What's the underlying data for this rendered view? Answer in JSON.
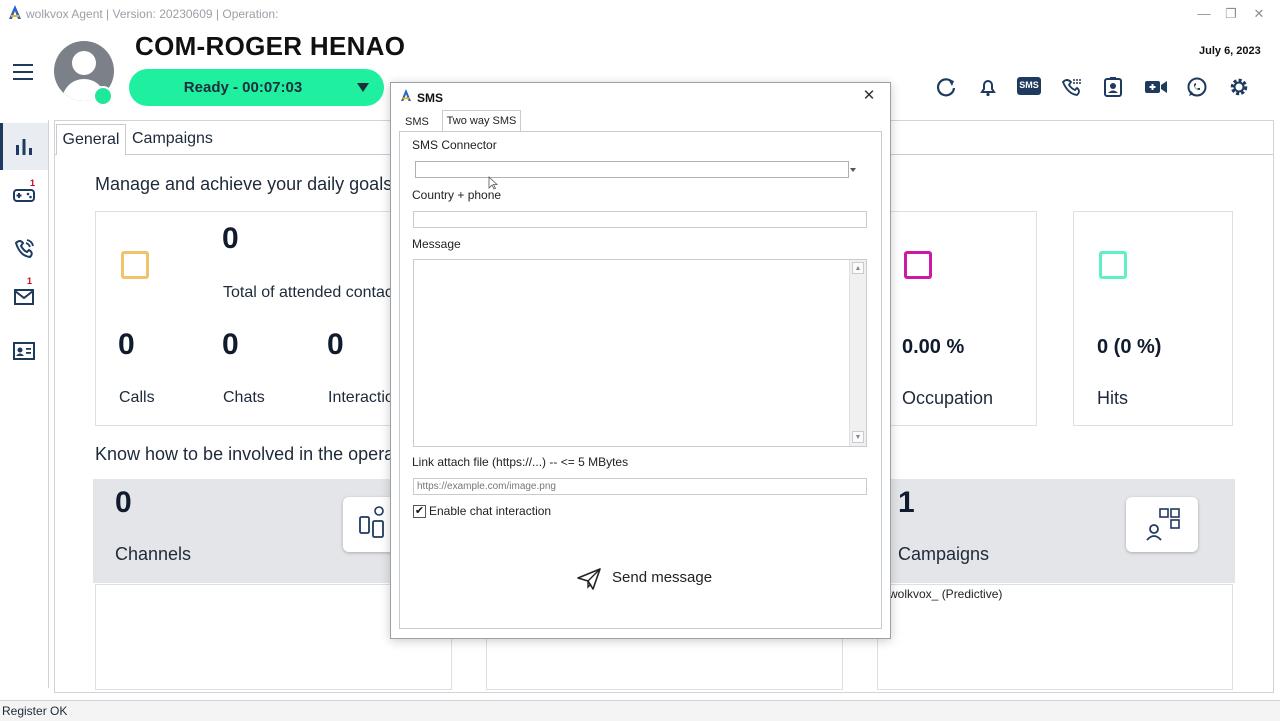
{
  "window": {
    "title": "wolkvox Agent | Version: 20230609  | Operation:",
    "minimize": "—",
    "restore": "❐",
    "close": "✕"
  },
  "header": {
    "agent_name": "COM-ROGER HENAO",
    "status": "Ready  -  00:07:03",
    "date": "July 6, 2023",
    "toolbar_icons": [
      "refresh-icon",
      "bell-icon",
      "sms-icon",
      "dialpad-icon",
      "contact-card-icon",
      "video-icon",
      "whatsapp-icon",
      "settings-icon"
    ],
    "sms_icon_text": "SMS"
  },
  "rail": {
    "items": [
      {
        "icon": "bar-chart-icon",
        "badge": ""
      },
      {
        "icon": "gamepad-icon",
        "badge": "1"
      },
      {
        "icon": "phone-icon",
        "badge": ""
      },
      {
        "icon": "mail-icon",
        "badge": "1"
      },
      {
        "icon": "id-card-icon",
        "badge": ""
      }
    ]
  },
  "tabs": {
    "general": "General",
    "campaigns": "Campaigns"
  },
  "goals": {
    "title": "Manage and achieve your daily goals",
    "total_value": "0",
    "total_label": "Total of attended contacts",
    "calls_value": "0",
    "calls_label": "Calls",
    "chats_value": "0",
    "chats_label": "Chats",
    "interactions_value": "0",
    "interactions_label": "Interactio",
    "occupation_value": "0.00 %",
    "occupation_label": "Occupation",
    "hits_value": "0 (0 %)",
    "hits_label": "Hits",
    "colors": {
      "total": "#f2c26b",
      "occupation": "#cc1aa6",
      "hits": "#5ff0c8"
    }
  },
  "involved": {
    "title": "Know how to be involved in the opera",
    "channels_value": "0",
    "channels_label": "Channels",
    "campaigns_value": "1",
    "campaigns_label": "Campaigns",
    "campaign_item": "wolkvox_ (Predictive)"
  },
  "footer": {
    "status": "Register OK"
  },
  "sms_dialog": {
    "title": "SMS",
    "close": "✕",
    "tab_sms": "SMS",
    "tab_two_way": "Two way SMS",
    "connector_label": "SMS Connector",
    "connector_value": "",
    "phone_label": "Country + phone",
    "phone_value": "",
    "message_label": "Message",
    "message_value": "",
    "link_label": "Link attach file (https://...) -- <= 5 MBytes",
    "link_placeholder": "https://example.com/image.png",
    "enable_chat_label": "Enable chat interaction",
    "enable_chat_checked": "✔",
    "send_label": "Send message"
  }
}
